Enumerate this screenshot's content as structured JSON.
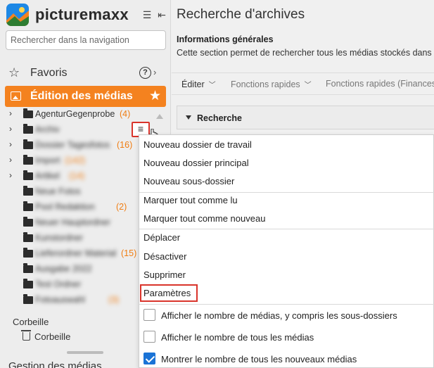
{
  "sidebar": {
    "brand": "picturemaxx",
    "search_placeholder": "Rechercher dans la navigation",
    "favoris_label": "Favoris",
    "help_label": "?",
    "active_section_label": "Édition des médias",
    "tree_first_item": "AgenturGegenprobe",
    "tree_first_count": "(4)",
    "tree_items": [
      {
        "name": "Archiv",
        "count": ""
      },
      {
        "name": "Dossier Tagesfotos",
        "count": "(16)"
      },
      {
        "name": "Import",
        "count": "(142)"
      },
      {
        "name": "Artikel",
        "count": "(14)"
      },
      {
        "name": "Neue Fotos",
        "count": ""
      },
      {
        "name": "Pool Redaktion",
        "count": "(2)"
      },
      {
        "name": "Neuer Hauptordner",
        "count": ""
      },
      {
        "name": "Kunstordner",
        "count": ""
      },
      {
        "name": "Lieferordner Material",
        "count": "(15)"
      },
      {
        "name": "Ausgabe 2022",
        "count": ""
      },
      {
        "name": "Test Ordner",
        "count": ""
      },
      {
        "name": "Fotoauswahl",
        "count": "(3)"
      }
    ],
    "trash_section_title": "Corbeille",
    "trash_item_label": "Corbeille",
    "bottom_item_label": "Gestion des médias"
  },
  "main": {
    "page_title": "Recherche d'archives",
    "info_title": "Informations générales",
    "info_desc": "Cette section permet de rechercher tous les médias stockés dans",
    "toolbar": {
      "edit_label": "Éditer",
      "quick_functions_label": "Fonctions rapides",
      "quick_functions_finance_label": "Fonctions rapides (Finances"
    },
    "section_label": "Recherche"
  },
  "context_menu": {
    "items": [
      "Nouveau dossier de travail",
      "Nouveau dossier principal",
      "Nouveau sous-dossier",
      "Marquer tout comme lu",
      "Marquer tout comme nouveau",
      "Déplacer",
      "Désactiver",
      "Supprimer",
      "Paramètres"
    ],
    "checkboxes": [
      {
        "label": "Afficher le nombre de médias, y compris les sous-dossiers",
        "checked": false
      },
      {
        "label": "Afficher le nombre de tous les médias",
        "checked": false
      },
      {
        "label": "Montrer le nombre de tous les nouveaux médias",
        "checked": true
      }
    ]
  },
  "colors": {
    "accent_orange": "#f4821f",
    "highlight_red": "#d9342b",
    "checkbox_blue": "#1a73d6",
    "count_orange": "#f07d12"
  }
}
